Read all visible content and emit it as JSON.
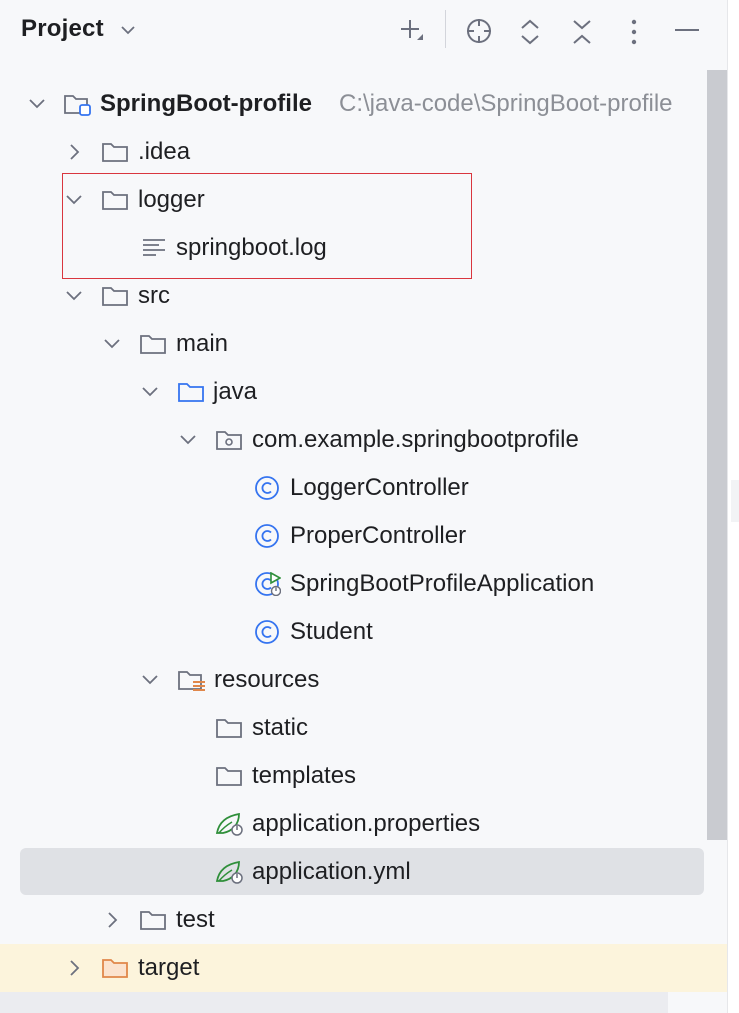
{
  "header": {
    "title": "Project",
    "toolbar_icons": [
      "add-icon",
      "locate-icon",
      "expand-all-icon",
      "collapse-all-icon",
      "more-icon",
      "minimize-icon"
    ]
  },
  "tree": {
    "root": {
      "label": "SpringBoot-profile",
      "path": "C:\\java-code\\SpringBoot-profile"
    },
    "idea": ".idea",
    "logger": "logger",
    "springboot_log": "springboot.log",
    "src": "src",
    "main": "main",
    "java": "java",
    "package": "com.example.springbootprofile",
    "logger_controller": "LoggerController",
    "proper_controller": "ProperController",
    "application_class": "SpringBootProfileApplication",
    "student": "Student",
    "resources": "resources",
    "static": "static",
    "templates": "templates",
    "application_properties": "application.properties",
    "application_yml": "application.yml",
    "test": "test",
    "target": "target"
  },
  "colors": {
    "selection": "#dfe1e5",
    "excluded_bg": "#fcf4dc",
    "highlight_border": "#d9363e",
    "class_icon": "#3574f0",
    "spring_icon": "#2f8f3a",
    "excluded_folder": "#e0874a"
  }
}
